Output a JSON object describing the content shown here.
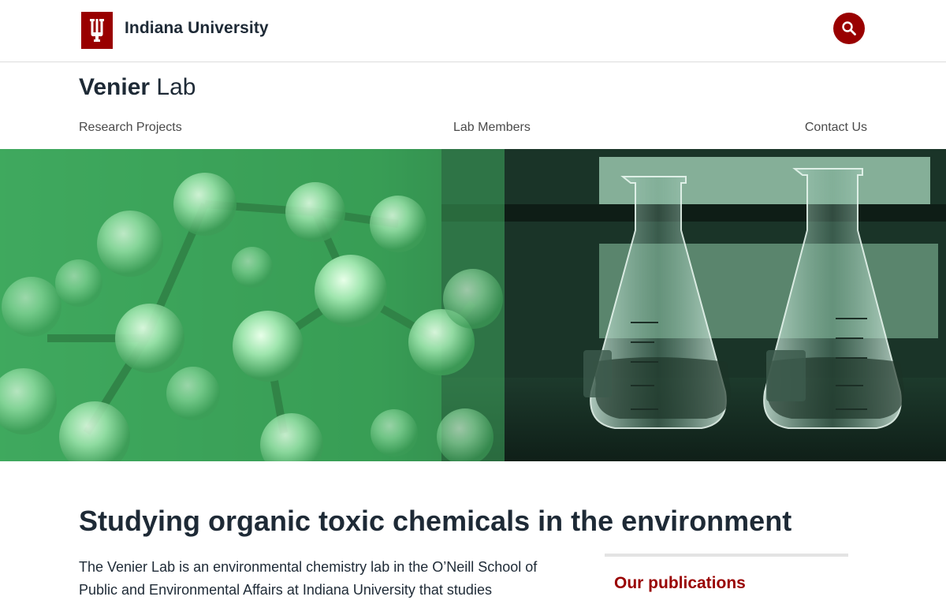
{
  "brand": {
    "university_name": "Indiana University",
    "logo_icon": "iu-trident-icon",
    "search_icon": "search-icon",
    "accent_color": "#990000"
  },
  "site": {
    "title_bold": "Venier",
    "title_light": "Lab"
  },
  "nav": {
    "items": [
      {
        "label": "Research Projects"
      },
      {
        "label": "Lab Members"
      },
      {
        "label": "Contact Us"
      }
    ]
  },
  "hero": {
    "image_theme": "green-molecules-and-flasks"
  },
  "main": {
    "heading": "Studying organic toxic chemicals in the environment",
    "intro_text": "The Venier Lab is an environmental chemistry lab in the O’Neill School of Public and Environmental Affairs at Indiana University that studies",
    "publications_title": "Our publications"
  }
}
